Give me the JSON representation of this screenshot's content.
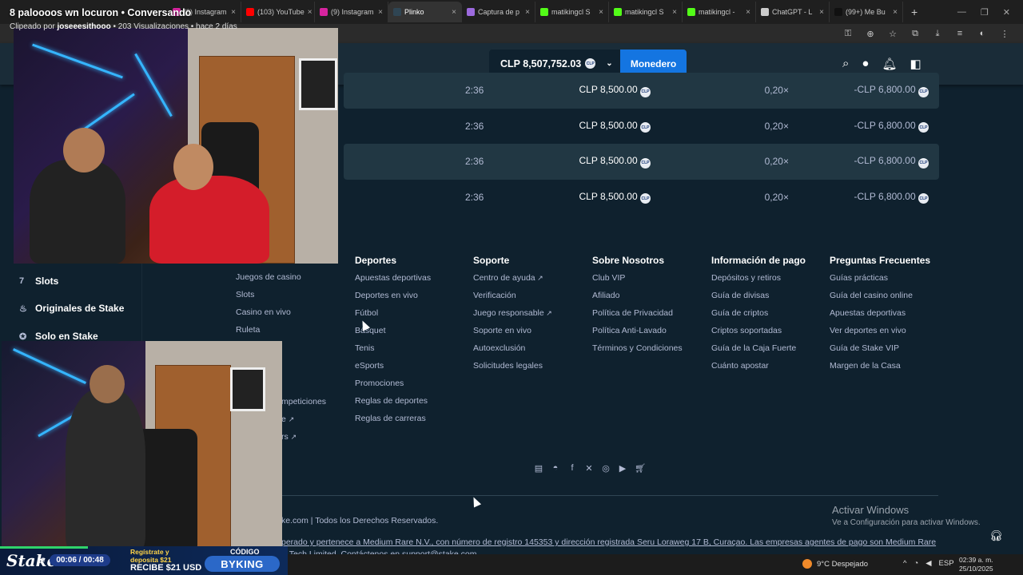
{
  "stream": {
    "title": "8 paloooos wn locuron • Conversando",
    "clipped_by_prefix": "Clipeado por ",
    "clipped_by_user": "joseeesithooo",
    "views": " • 203 Visualizaciones • hace 2 días"
  },
  "browser": {
    "tabs": [
      {
        "label": "(9) Instagram",
        "color": "#d6249f"
      },
      {
        "label": "(103) YouTube",
        "color": "#ff0000"
      },
      {
        "label": "(9) Instagram",
        "color": "#d6249f"
      },
      {
        "label": "Plinko",
        "color": "#2f4553",
        "active": true
      },
      {
        "label": "Captura de p",
        "color": "#9c6ade"
      },
      {
        "label": "matikingcl S",
        "color": "#53fc18"
      },
      {
        "label": "matikingcl S",
        "color": "#53fc18"
      },
      {
        "label": "matikingcl -",
        "color": "#53fc18"
      },
      {
        "label": "ChatGPT - L",
        "color": "#cccccc"
      },
      {
        "label": "(99+) Me Bu",
        "color": "#111111"
      }
    ]
  },
  "header": {
    "balance": "CLP 8,507,752.03",
    "currency_badge": "CLP",
    "wallet_label": "Monedero"
  },
  "bets": [
    {
      "time": "2:36",
      "amount": "CLP 8,500.00",
      "multiplier": "0,20×",
      "payout": "-CLP 6,800.00"
    },
    {
      "time": "2:36",
      "amount": "CLP 8,500.00",
      "multiplier": "0,20×",
      "payout": "-CLP 6,800.00"
    },
    {
      "time": "2:36",
      "amount": "CLP 8,500.00",
      "multiplier": "0,20×",
      "payout": "-CLP 6,800.00"
    },
    {
      "time": "2:36",
      "amount": "CLP 8,500.00",
      "multiplier": "0,20×",
      "payout": "-CLP 6,800.00"
    }
  ],
  "sidebar": {
    "items": [
      "Slots",
      "Originales de Stake",
      "Solo en Stake"
    ]
  },
  "footer": {
    "col_casino": {
      "items": [
        "Juegos de casino",
        "Slots",
        "Casino en vivo",
        "Ruleta"
      ]
    },
    "col_casino_partial": [
      "mpeticiones",
      "e",
      "rs"
    ],
    "col_sports": {
      "title": "Deportes",
      "items": [
        "Apuestas deportivas",
        "Deportes en vivo",
        "Fútbol",
        "Básquet",
        "Tenis",
        "eSports",
        "Promociones",
        "Reglas de deportes",
        "Reglas de carreras"
      ]
    },
    "col_support": {
      "title": "Soporte",
      "items": [
        "Centro de ayuda",
        "Verificación",
        "Juego responsable",
        "Soporte en vivo",
        "Autoexclusión",
        "Solicitudes legales"
      ]
    },
    "col_about": {
      "title": "Sobre Nosotros",
      "items": [
        "Club VIP",
        "Afiliado",
        "Política de Privacidad",
        "Política Anti-Lavado",
        "Términos y Condiciones"
      ]
    },
    "col_payment": {
      "title": "Información de pago",
      "items": [
        "Depósitos y retiros",
        "Guía de divisas",
        "Guía de criptos",
        "Criptos soportadas",
        "Guía de la Caja Fuerte",
        "Cuánto apostar"
      ]
    },
    "col_faq": {
      "title": "Preguntas Frecuentes",
      "items": [
        "Guías prácticas",
        "Guía del casino online",
        "Apuestas deportivas",
        "Ver deportes en vivo",
        "Guía de Stake VIP",
        "Margen de la Casa"
      ]
    },
    "copyright": "ke.com | Todos los Derechos Reservados.",
    "legal_line1": "perado y pertenece a Medium Rare N.V., con número de registro 145353 y dirección registrada Seru Loraweg 17 B, Curaçao. Las empresas agentes de pago son Medium Rare",
    "legal_line2": "S Tech Limited. Contáctenos en support@stake.com"
  },
  "windows": {
    "activate_title": "Activar Windows",
    "activate_sub": "Ve a Configuración para activar Windows.",
    "weather": "9°C  Despejado",
    "lang": "ESP",
    "time": "02:39 a. m.",
    "date": "25/10/2025"
  },
  "overlay": {
    "logo": "Stake",
    "player_time": "00:06 / 00:48",
    "promo_line1": "Regístrate y",
    "promo_line2": "deposita $21",
    "promo_line3": "RECIBE $21 USD",
    "code_label": "CÓDIGO",
    "code_value": "BYKING"
  }
}
